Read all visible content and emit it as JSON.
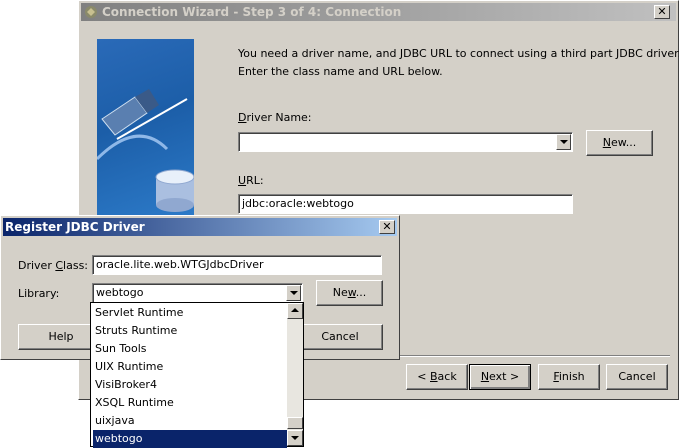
{
  "wizard": {
    "title": "Connection Wizard - Step 3 of 4: Connection",
    "description_line1": "You need a driver name, and JDBC URL to connect using a third part JDBC driver.",
    "description_line2": "Enter the class name and URL below.",
    "driver_name_label_u": "D",
    "driver_name_label_rest": "river Name:",
    "driver_name_value": "",
    "new_button_u": "N",
    "new_button_rest": "ew...",
    "url_label_u": "U",
    "url_label_rest": "RL:",
    "url_value": "jdbc:oracle:webtogo",
    "back_prefix": "< ",
    "back_u": "B",
    "back_rest": "ack",
    "next_u": "N",
    "next_rest": "ext >",
    "finish_u": "F",
    "finish_rest": "inish",
    "cancel_label": "Cancel"
  },
  "register": {
    "title": "Register JDBC Driver",
    "driver_class_label_pre": "Driver ",
    "driver_class_label_u": "C",
    "driver_class_label_post": "lass:",
    "driver_class_value": "oracle.lite.web.WTGJdbcDriver",
    "library_label": "Library:",
    "library_value": "webtogo",
    "new_button_pre": "Ne",
    "new_button_u": "w",
    "new_button_post": "...",
    "help_label": "Help",
    "cancel_label": "Cancel"
  },
  "library_options": [
    "Servlet Runtime",
    "Struts Runtime",
    "Sun Tools",
    "UIX Runtime",
    "VisiBroker4",
    "XSQL Runtime",
    "uixjava",
    "webtogo"
  ],
  "selected_option": "webtogo",
  "colors": {
    "selection": "#0a246a",
    "dialog_face": "#d4d0c8",
    "illustration_blue": "#1c5ea8"
  }
}
